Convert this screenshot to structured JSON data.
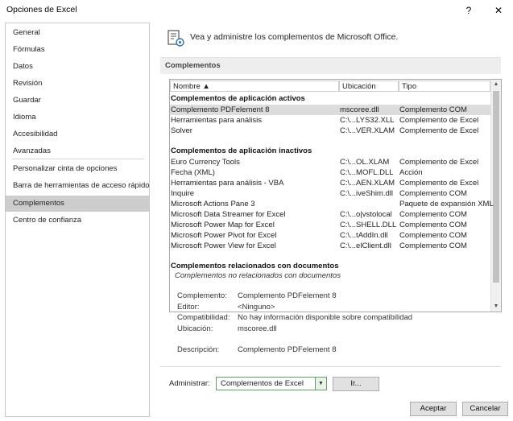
{
  "window": {
    "title": "Opciones de Excel",
    "help_label": "?",
    "close_label": "✕"
  },
  "sidebar": {
    "items": [
      {
        "label": "General"
      },
      {
        "label": "Fórmulas"
      },
      {
        "label": "Datos"
      },
      {
        "label": "Revisión"
      },
      {
        "label": "Guardar"
      },
      {
        "label": "Idioma"
      },
      {
        "label": "Accesibilidad"
      },
      {
        "label": "Avanzadas"
      },
      {
        "label": "Personalizar cinta de opciones"
      },
      {
        "label": "Barra de herramientas de acceso rápido"
      },
      {
        "label": "Complementos",
        "selected": true
      },
      {
        "label": "Centro de confianza"
      }
    ]
  },
  "header": {
    "text": "Vea y administre los complementos de Microsoft Office.",
    "icon": "addins-gear-icon"
  },
  "section": {
    "title": "Complementos"
  },
  "grid": {
    "columns": [
      "Nombre ▲",
      "Ubicación",
      "Tipo"
    ],
    "groups": [
      {
        "title": "Complementos de aplicación activos",
        "rows": [
          {
            "name": "Complemento PDFelement 8",
            "location": "mscoree.dll",
            "type": "Complemento COM",
            "selected": true
          },
          {
            "name": "Herramientas para análisis",
            "location": "C:\\...LYS32.XLL",
            "type": "Complemento de Excel"
          },
          {
            "name": "Solver",
            "location": "C:\\...VER.XLAM",
            "type": "Complemento de Excel"
          }
        ]
      },
      {
        "title": "Complementos de aplicación inactivos",
        "rows": [
          {
            "name": "Euro Currency Tools",
            "location": "C:\\...OL.XLAM",
            "type": "Complemento de Excel"
          },
          {
            "name": "Fecha (XML)",
            "location": "C:\\...MOFL.DLL",
            "type": "Acción"
          },
          {
            "name": "Herramientas para análisis - VBA",
            "location": "C:\\...AEN.XLAM",
            "type": "Complemento de Excel"
          },
          {
            "name": "Inquire",
            "location": "C:\\...iveShim.dll",
            "type": "Complemento COM"
          },
          {
            "name": "Microsoft Actions Pane 3",
            "location": "",
            "type": "Paquete de expansión XML"
          },
          {
            "name": "Microsoft Data Streamer for Excel",
            "location": "C:\\...o|vstolocal",
            "type": "Complemento COM"
          },
          {
            "name": "Microsoft Power Map for Excel",
            "location": "C:\\...SHELL.DLL",
            "type": "Complemento COM"
          },
          {
            "name": "Microsoft Power Pivot for Excel",
            "location": "C:\\...tAddIn.dll",
            "type": "Complemento COM"
          },
          {
            "name": "Microsoft Power View for Excel",
            "location": "C:\\...elClient.dll",
            "type": "Complemento COM"
          }
        ]
      },
      {
        "title": "Complementos relacionados con documentos",
        "note": "Complementos no relacionados con documentos",
        "rows": []
      }
    ]
  },
  "details": {
    "complemento_label": "Complemento:",
    "complemento_value": "Complemento PDFelement 8",
    "editor_label": "Editor:",
    "editor_value": "<Ninguno>",
    "compat_label": "Compatibilidad:",
    "compat_value": "No hay información disponible sobre compatibilidad",
    "ubicacion_label": "Ubicación:",
    "ubicacion_value": "mscoree.dll",
    "descripcion_label": "Descripción:",
    "descripcion_value": "Complemento PDFelement 8"
  },
  "manage": {
    "label": "Administrar:",
    "selected": "Complementos de Excel",
    "go_label": "Ir..."
  },
  "footer": {
    "ok_label": "Aceptar",
    "cancel_label": "Cancelar"
  }
}
